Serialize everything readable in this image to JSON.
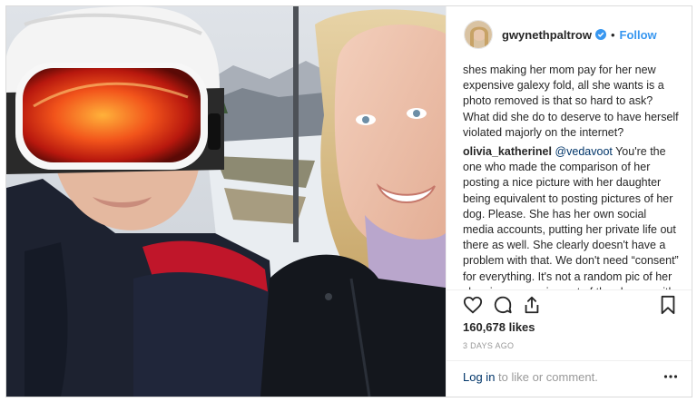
{
  "post": {
    "username": "gwynethpaltrow",
    "follow_label": "Follow",
    "dot": "•",
    "likes": "160,678 likes",
    "time_ago": "3 DAYS AGO",
    "login_link": "Log in",
    "login_rest": " to like or comment."
  },
  "comments": [
    {
      "user": "",
      "mention": "",
      "text": "shes making her mom pay for her new expensive galexy fold, all she wants is a photo removed is that so hard to ask? What did she do to deserve to have herself violated majorly on the internet?"
    },
    {
      "user": "olivia_katherinel",
      "mention": "@vedavoot",
      "text": " You're the one who made the comparison of her posting a nice picture with her daughter being equivalent to posting pictures of her dog. Please. She has her own social media accounts, putting her private life out there as well. She clearly doesn't have a problem with that. We don't need “consent” for everything. It's not a random pic of her sleeping, or coming out of the shower with a towel on. Do we"
    }
  ],
  "icons": {
    "verified": "verified-badge-icon",
    "like": "heart-icon",
    "comment": "comment-bubble-icon",
    "share": "share-icon",
    "save": "bookmark-icon",
    "more": "more-options-icon"
  },
  "colors": {
    "link": "#3897f0",
    "mention": "#003569",
    "muted": "#999999",
    "text": "#262626",
    "border": "#dbdbdb"
  }
}
